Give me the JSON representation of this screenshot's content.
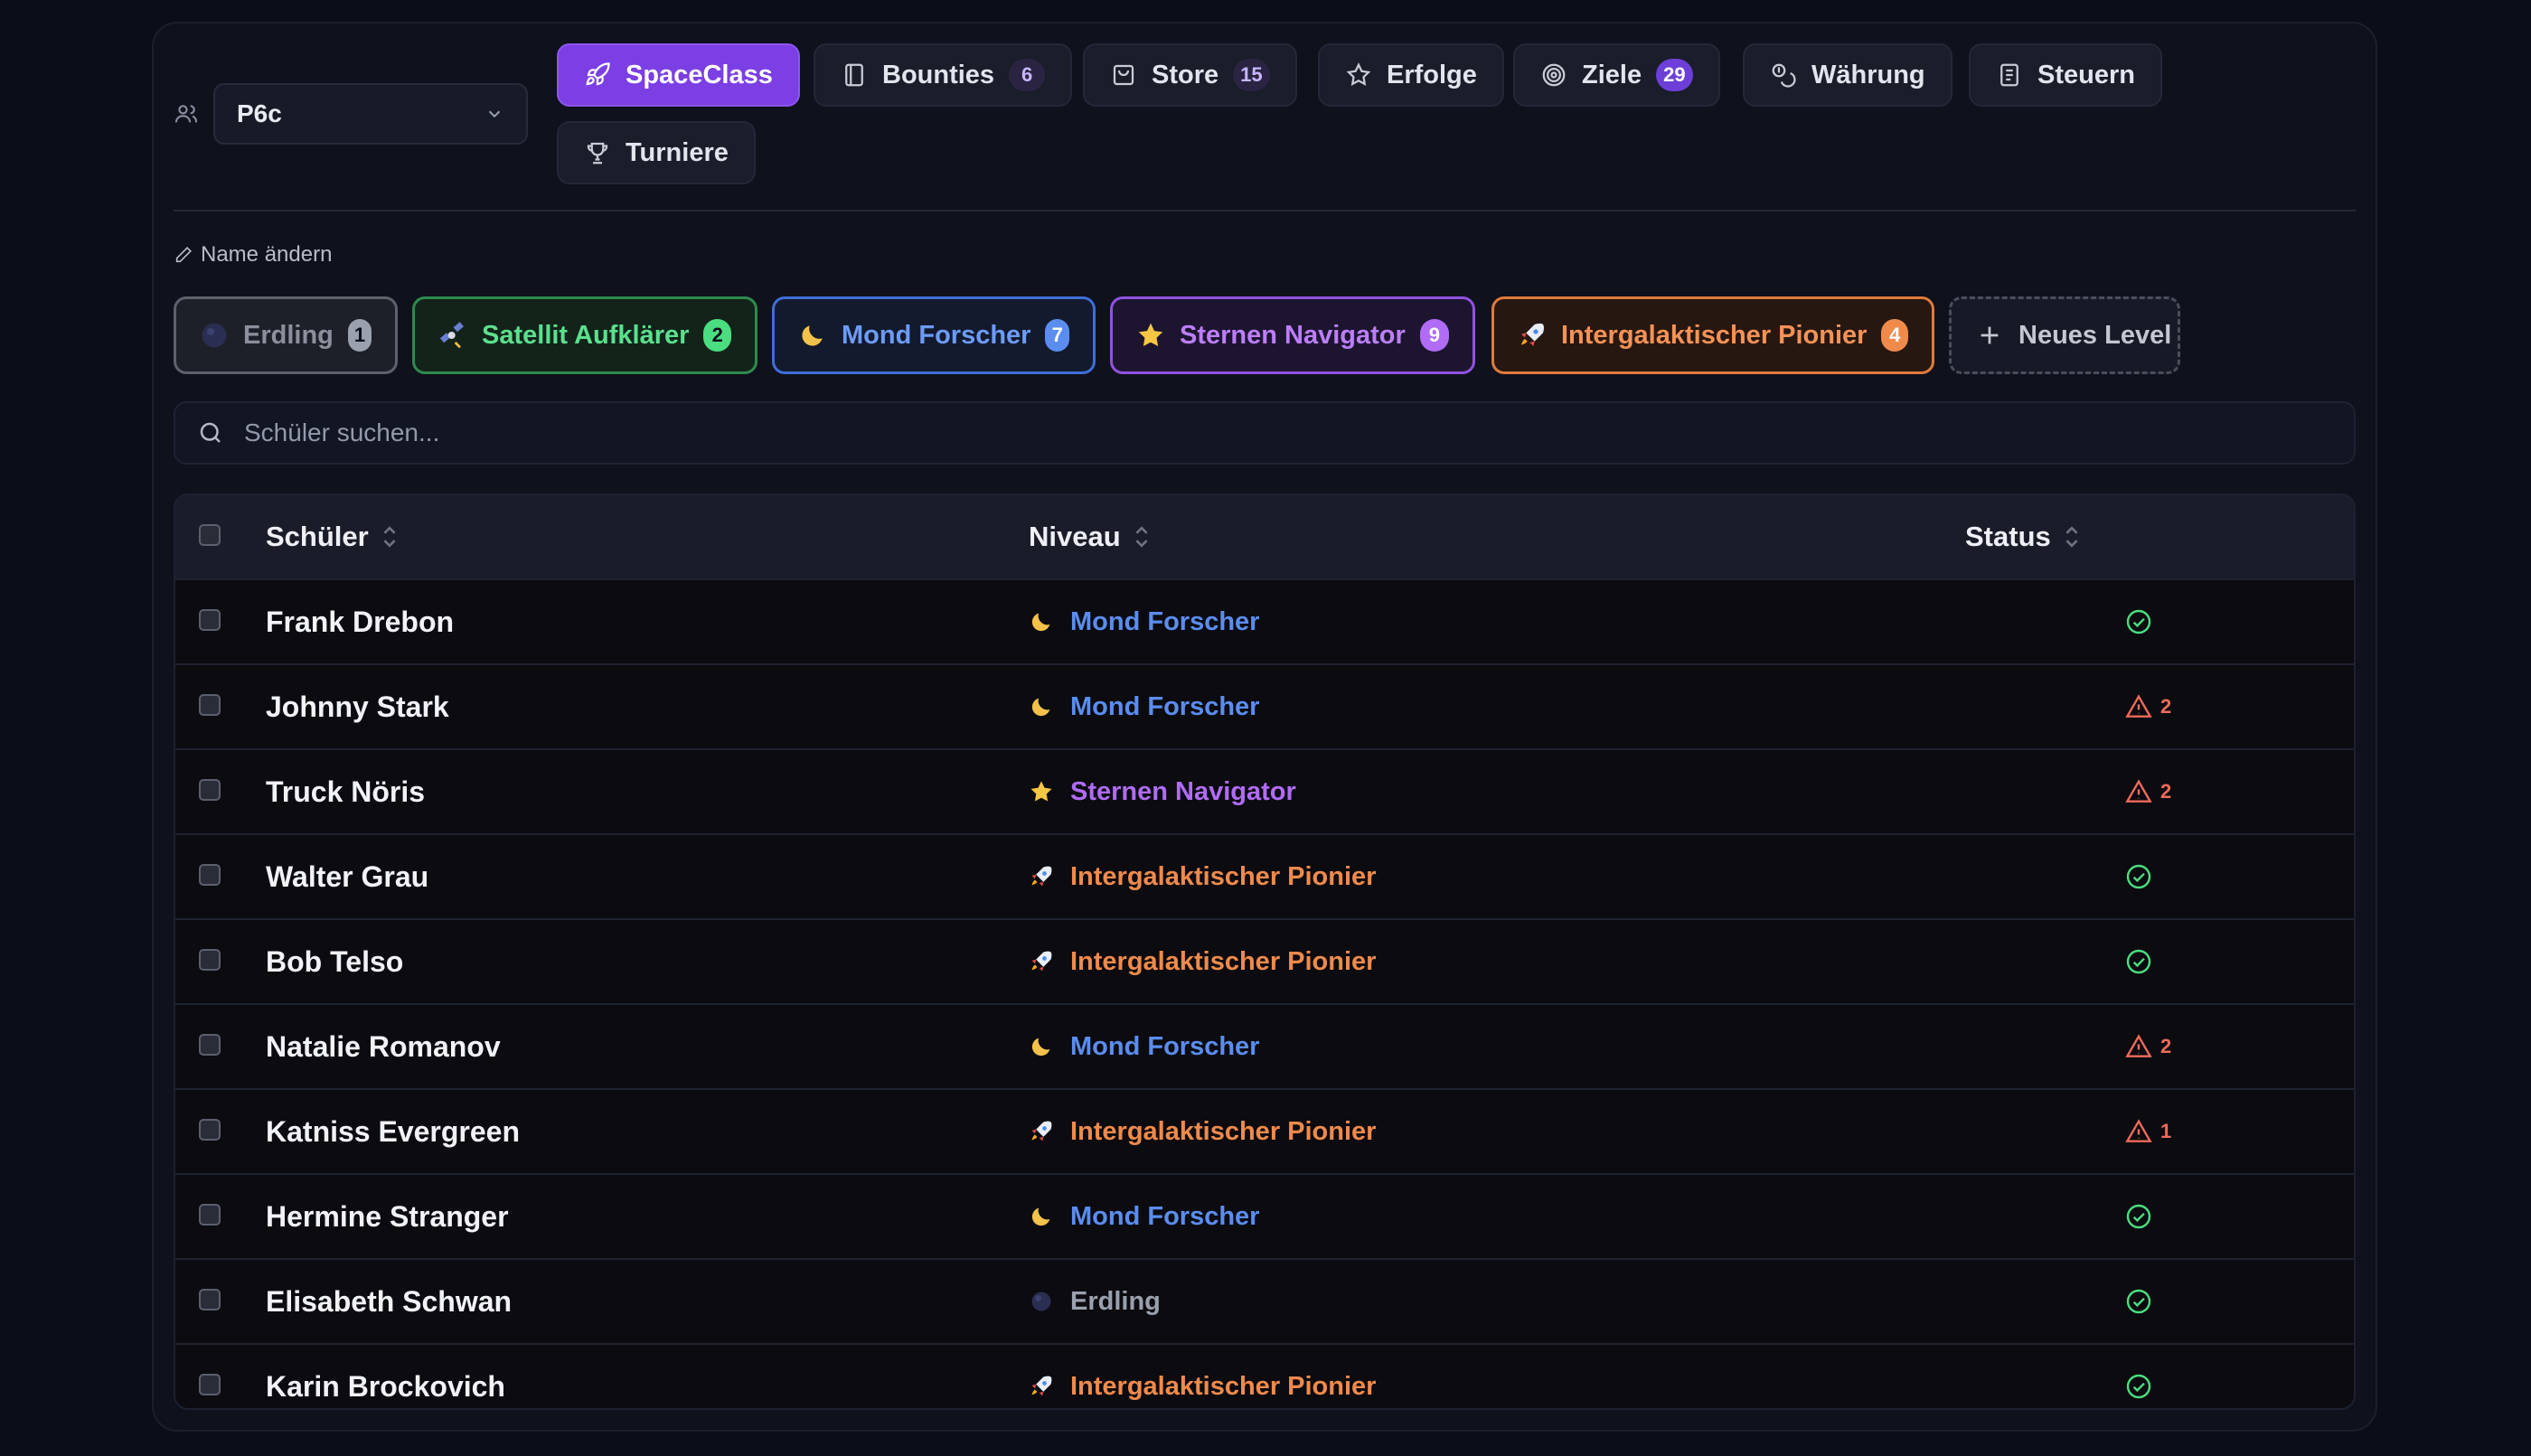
{
  "class_selector": {
    "value": "P6c",
    "icon": "users-icon"
  },
  "nav": [
    {
      "label": "SpaceClass",
      "icon": "rocket-icon",
      "active": true
    },
    {
      "label": "Bounties",
      "icon": "book-icon",
      "badge": "6"
    },
    {
      "label": "Store",
      "icon": "store-icon",
      "badge": "15"
    },
    {
      "label": "Erfolge",
      "icon": "star-icon"
    },
    {
      "label": "Ziele",
      "icon": "target-icon",
      "badge": "29"
    },
    {
      "label": "Währung",
      "icon": "coins-icon"
    },
    {
      "label": "Steuern",
      "icon": "receipt-icon"
    },
    {
      "label": "Turniere",
      "icon": "trophy-icon"
    }
  ],
  "rename_label": "Name ändern",
  "levels": [
    {
      "label": "Erdling",
      "count": "1",
      "color": "#9aa0ad"
    },
    {
      "label": "Satellit Aufklärer",
      "count": "2",
      "color": "#4ade80"
    },
    {
      "label": "Mond Forscher",
      "count": "7",
      "color": "#5b8def"
    },
    {
      "label": "Sternen Navigator",
      "count": "9",
      "color": "#b06cf5"
    },
    {
      "label": "Intergalaktischer Pionier",
      "count": "4",
      "color": "#f08a4b"
    }
  ],
  "new_level_label": "Neues Level",
  "search": {
    "placeholder": "Schüler suchen..."
  },
  "table": {
    "headers": {
      "student": "Schüler",
      "level": "Niveau",
      "status": "Status"
    },
    "rows": [
      {
        "name": "Frank Drebon",
        "level": "Mond Forscher",
        "status": "ok"
      },
      {
        "name": "Johnny Stark",
        "level": "Mond Forscher",
        "status": "warn",
        "warnings": "2"
      },
      {
        "name": "Truck Nöris",
        "level": "Sternen Navigator",
        "status": "warn",
        "warnings": "2"
      },
      {
        "name": "Walter Grau",
        "level": "Intergalaktischer Pionier",
        "status": "ok"
      },
      {
        "name": "Bob Telso",
        "level": "Intergalaktischer Pionier",
        "status": "ok"
      },
      {
        "name": "Natalie Romanov",
        "level": "Mond Forscher",
        "status": "warn",
        "warnings": "2"
      },
      {
        "name": "Katniss Evergreen",
        "level": "Intergalaktischer Pionier",
        "status": "warn",
        "warnings": "1"
      },
      {
        "name": "Hermine Stranger",
        "level": "Mond Forscher",
        "status": "ok"
      },
      {
        "name": "Elisabeth Schwan",
        "level": "Erdling",
        "status": "ok"
      },
      {
        "name": "Karin Brockovich",
        "level": "Intergalaktischer Pionier",
        "status": "ok"
      }
    ]
  }
}
